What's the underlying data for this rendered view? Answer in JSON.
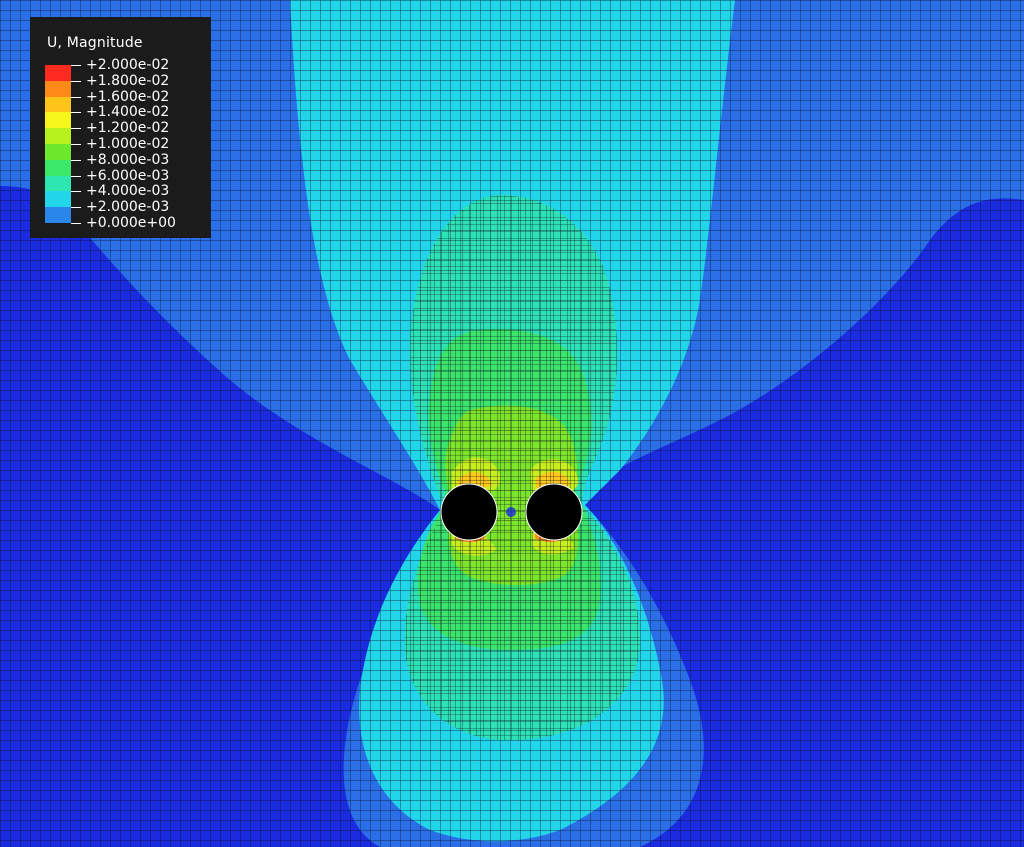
{
  "legend": {
    "title": "U, Magnitude",
    "levels": [
      {
        "label": "+2.000e-02",
        "color": "#ff2a1f"
      },
      {
        "label": "+1.800e-02",
        "color": "#ff8a1a"
      },
      {
        "label": "+1.600e-02",
        "color": "#ffc41a"
      },
      {
        "label": "+1.400e-02",
        "color": "#f6f51c"
      },
      {
        "label": "+1.200e-02",
        "color": "#b8f21e"
      },
      {
        "label": "+1.000e-02",
        "color": "#6ee82a"
      },
      {
        "label": "+8.000e-03",
        "color": "#3be86a"
      },
      {
        "label": "+6.000e-03",
        "color": "#2ee6b0"
      },
      {
        "label": "+4.000e-03",
        "color": "#22d7ea"
      },
      {
        "label": "+2.000e-03",
        "color": "#2a86ea"
      },
      {
        "label": "+0.000e+00",
        "color": "#1a2be0"
      }
    ]
  },
  "field_colors": {
    "level_0": "#1a2be0",
    "level_1": "#2a6ee8",
    "level_2": "#22d5ea",
    "level_3": "#2ee2b8",
    "level_4": "#3be46a",
    "level_5": "#7ee62a",
    "level_6": "#c8ee1e",
    "level_7": "#ffc81a",
    "level_8": "#ff8a1a",
    "level_9": "#ff2a1f",
    "mesh": "#0b1020",
    "hole": "#000000"
  }
}
